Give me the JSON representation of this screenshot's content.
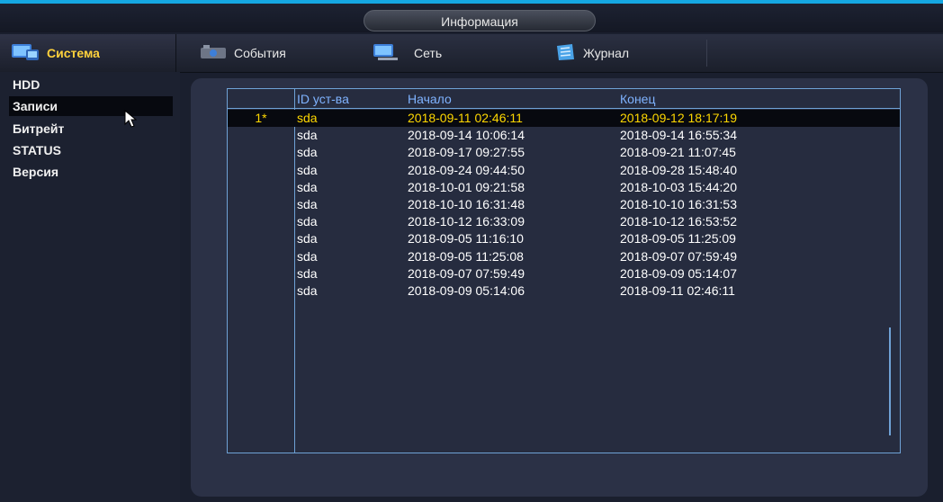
{
  "window": {
    "title": "Информация"
  },
  "tabs": [
    {
      "label": "Система",
      "icon": "system-icon",
      "active": true
    },
    {
      "label": "События",
      "icon": "events-icon",
      "active": false
    },
    {
      "label": "Сеть",
      "icon": "network-icon",
      "active": false
    },
    {
      "label": "Журнал",
      "icon": "log-icon",
      "active": false
    }
  ],
  "sidebar": {
    "items": [
      {
        "label": "HDD"
      },
      {
        "label": "Записи"
      },
      {
        "label": "Битрейт"
      },
      {
        "label": "STATUS"
      },
      {
        "label": "Версия"
      }
    ],
    "selected_index": 1
  },
  "table": {
    "columns": [
      "",
      "ID уст-ва",
      "Начало",
      "Конец"
    ],
    "selected_index": 0,
    "rows": [
      {
        "index": "1*",
        "device": "sda",
        "start": "2018-09-11 02:46:11",
        "end": "2018-09-12 18:17:19"
      },
      {
        "index": "",
        "device": "sda",
        "start": "2018-09-14 10:06:14",
        "end": "2018-09-14 16:55:34"
      },
      {
        "index": "",
        "device": "sda",
        "start": "2018-09-17 09:27:55",
        "end": "2018-09-21 11:07:45"
      },
      {
        "index": "",
        "device": "sda",
        "start": "2018-09-24 09:44:50",
        "end": "2018-09-28 15:48:40"
      },
      {
        "index": "",
        "device": "sda",
        "start": "2018-10-01 09:21:58",
        "end": "2018-10-03 15:44:20"
      },
      {
        "index": "",
        "device": "sda",
        "start": "2018-10-10 16:31:48",
        "end": "2018-10-10 16:31:53"
      },
      {
        "index": "",
        "device": "sda",
        "start": "2018-10-12 16:33:09",
        "end": "2018-10-12 16:53:52"
      },
      {
        "index": "",
        "device": "sda",
        "start": "2018-09-05 11:16:10",
        "end": "2018-09-05 11:25:09"
      },
      {
        "index": "",
        "device": "sda",
        "start": "2018-09-05 11:25:08",
        "end": "2018-09-07 07:59:49"
      },
      {
        "index": "",
        "device": "sda",
        "start": "2018-09-07 07:59:49",
        "end": "2018-09-09 05:14:07"
      },
      {
        "index": "",
        "device": "sda",
        "start": "2018-09-09 05:14:06",
        "end": "2018-09-11 02:46:11"
      }
    ]
  },
  "colors": {
    "accent": "#15a7e3",
    "active_tab_text": "#ffd23c",
    "selected_row_text": "#ffd800",
    "header_text": "#7fb3ff",
    "table_border": "#6fa2d6"
  }
}
